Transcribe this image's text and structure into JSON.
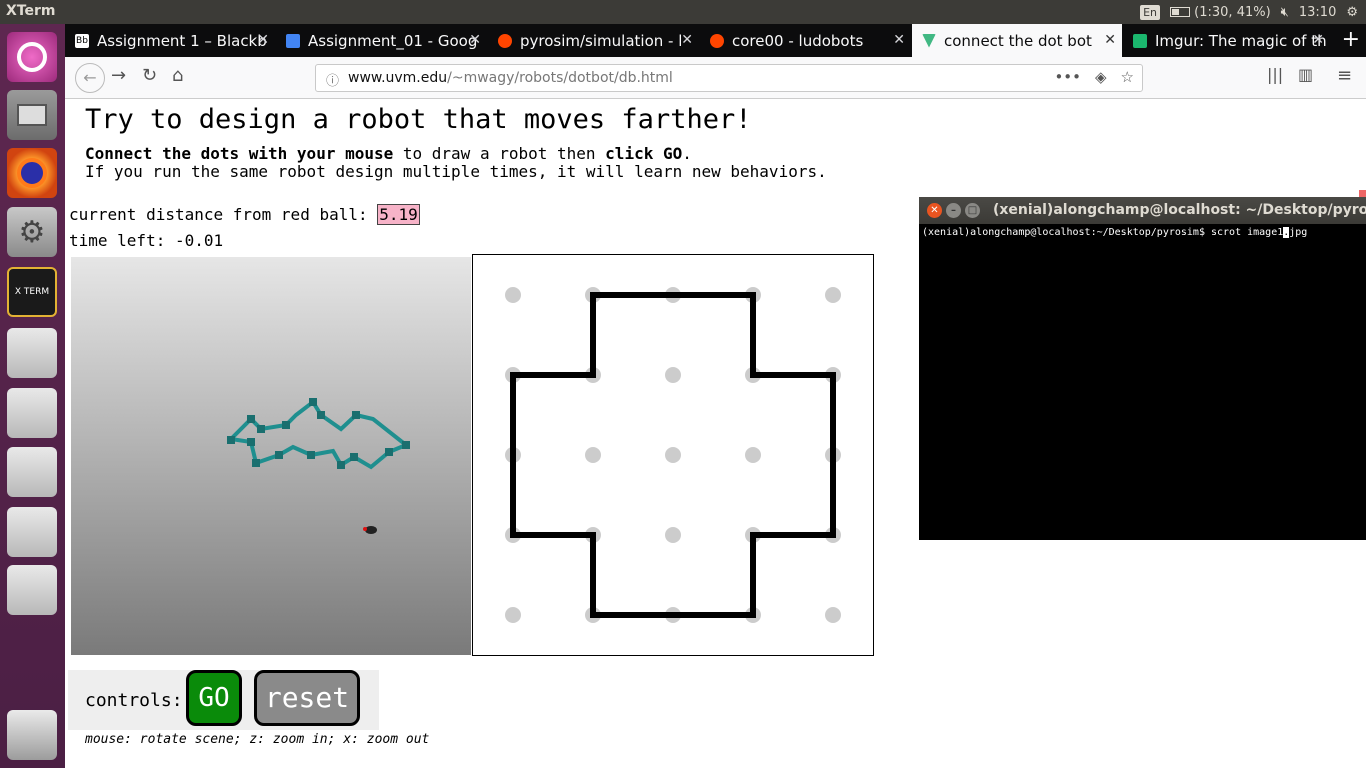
{
  "system": {
    "app_title": "XTerm",
    "keyboard": "En",
    "battery": "(1:30, 41%)",
    "volume_icon": "volume-muted-icon",
    "clock": "13:10",
    "power_icon": "gear-icon"
  },
  "launcher": {
    "items": [
      "dash-icon",
      "files-icon",
      "firefox-icon",
      "settings-icon",
      "xterm-icon",
      "drive-icon",
      "drive-icon",
      "drive-icon",
      "drive-icon",
      "drive-icon",
      "trash-icon"
    ],
    "xterm_label": "X TERM"
  },
  "tabs": [
    {
      "label": "Assignment 1 – Blackb",
      "icon": "blackboard-icon",
      "color": "#ffffff"
    },
    {
      "label": "Assignment_01 - Goog",
      "icon": "docs-icon",
      "color": "#4285f4"
    },
    {
      "label": "pyrosim/simulation - l",
      "icon": "reddit-icon",
      "color": "#ff4500"
    },
    {
      "label": "core00 - ludobots",
      "icon": "reddit-icon",
      "color": "#ff4500"
    },
    {
      "label": "connect the dot bot",
      "icon": "vue-icon",
      "color": "#41b883",
      "active": true
    },
    {
      "label": "Imgur: The magic of th",
      "icon": "imgur-icon",
      "color": "#1bb76e"
    }
  ],
  "nav": {
    "url_host": "www.uvm.edu",
    "url_path": "/~mwagy/robots/dotbot/db.html",
    "more": "•••"
  },
  "page": {
    "heading": "Try to design a robot that moves farther!",
    "instr_line1_bold1": "Connect the dots with your mouse",
    "instr_line1_mid": " to draw a robot then ",
    "instr_line1_bold2": "click GO",
    "instr_line1_end": ".",
    "instr_line2": "If you run the same robot design multiple times, it will learn new behaviors.",
    "distance_label": "current distance from red ball: ",
    "distance_value": "5.19",
    "time_label": "time left: -0.01",
    "controls_label": "controls:",
    "go_label": "GO",
    "reset_label": "reset",
    "hint": "mouse: rotate scene; z: zoom in; x: zoom out"
  },
  "terminal": {
    "title": "(xenial)alongchamp@localhost: ~/Desktop/pyrosim",
    "prompt": "(xenial)alongchamp@localhost:~/Desktop/pyrosim$ scrot image1",
    "cursor_char": ".",
    "after_cursor": "jpg"
  }
}
